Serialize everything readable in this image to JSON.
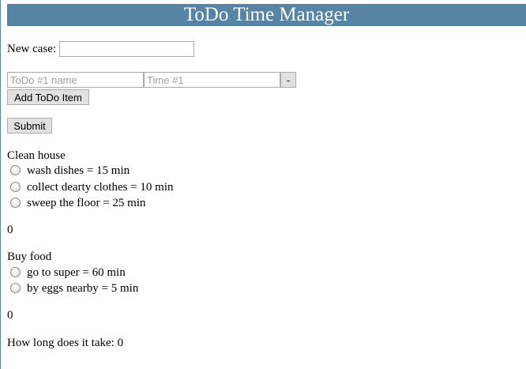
{
  "header": {
    "title": "ToDo Time Manager"
  },
  "form": {
    "new_case_label": "New case:",
    "new_case_value": "",
    "todo_name_placeholder": "ToDo #1 name",
    "todo_time_placeholder": "Time #1",
    "remove_label": "-",
    "add_label": "Add ToDo Item",
    "submit_label": "Submit"
  },
  "cases": [
    {
      "title": "Clean house",
      "items": [
        {
          "label": "wash dishes = 15 min"
        },
        {
          "label": "collect dearty clothes = 10 min"
        },
        {
          "label": "sweep the floor = 25 min"
        }
      ],
      "total": "0"
    },
    {
      "title": "Buy food",
      "items": [
        {
          "label": "go to super = 60 min"
        },
        {
          "label": "by eggs nearby = 5 min"
        }
      ],
      "total": "0"
    }
  ],
  "summary": {
    "text": "How long does it take: 0"
  },
  "colors": {
    "header_bg": "#5783a4",
    "header_text": "#ffffff"
  }
}
